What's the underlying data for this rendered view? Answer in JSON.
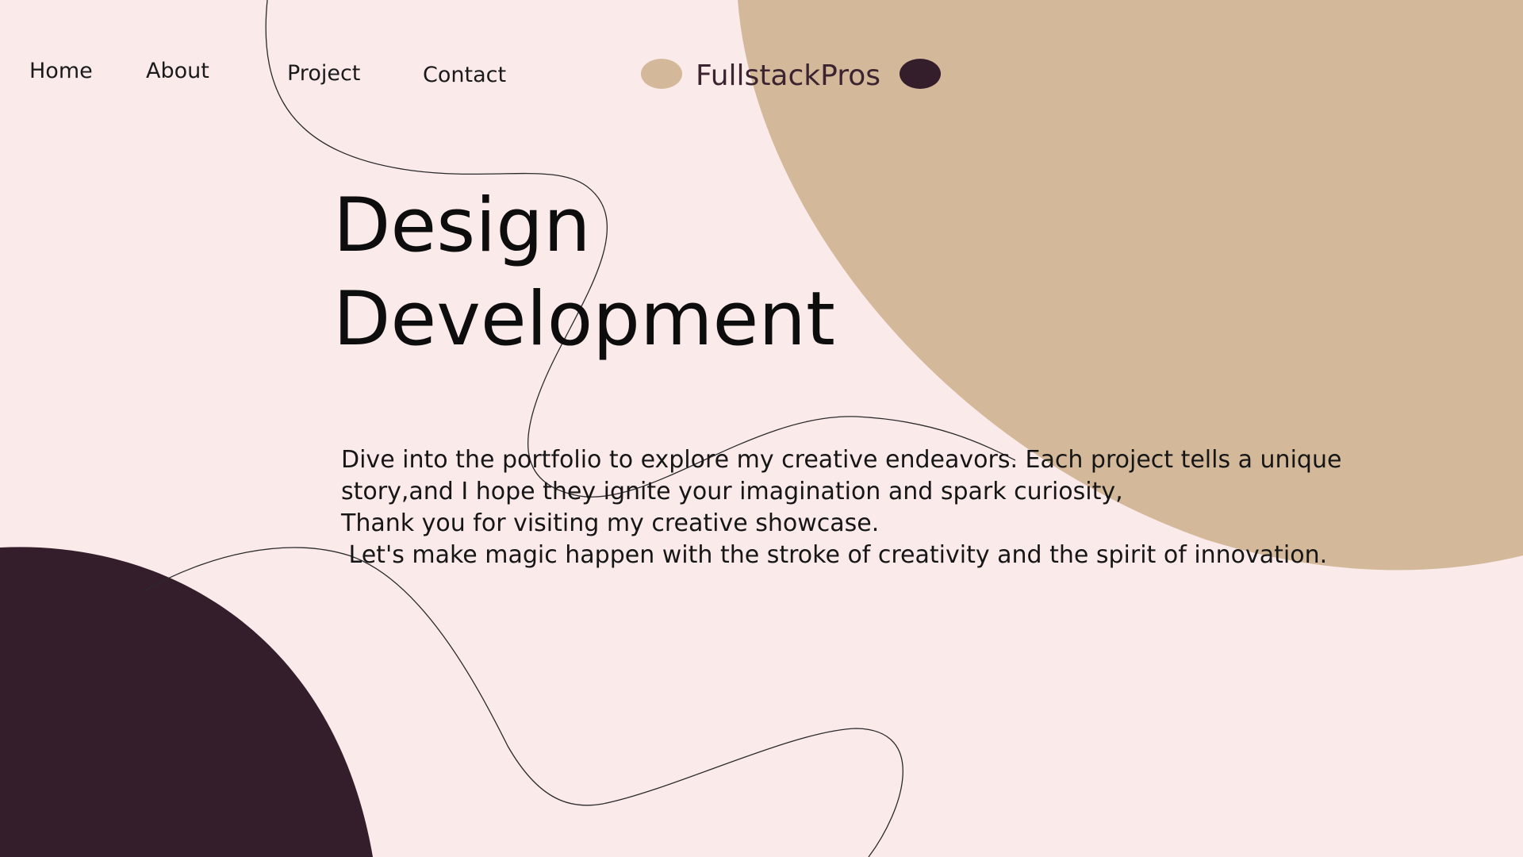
{
  "nav": {
    "home": "Home",
    "about": "About",
    "project": "Project",
    "contact": "Contact"
  },
  "brand": {
    "name": "FullstackPros"
  },
  "hero": {
    "line1": "Design",
    "line2": "Development"
  },
  "intro": {
    "line1": "Dive into the portfolio to explore my creative endeavors. Each project tells a unique",
    "line2": "story,and I hope they ignite your imagination and spark curiosity,",
    "line3": "Thank you for visiting my creative showcase.",
    "line4": " Let's make magic happen with the stroke of creativity and the spirit of innovation."
  },
  "colors": {
    "background": "#FBEAEA",
    "tan": "#D3B89A",
    "plum": "#341E2C",
    "text": "#111111"
  }
}
